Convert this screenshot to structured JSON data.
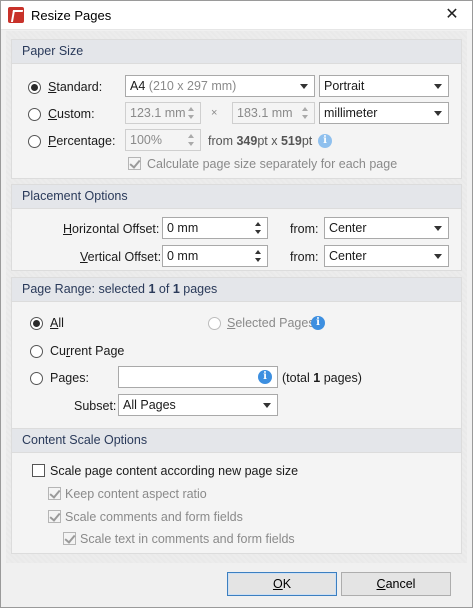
{
  "window": {
    "title": "Resize Pages",
    "close_glyph": "✕"
  },
  "paper_size": {
    "title": "Paper Size",
    "standard": {
      "label_u": "S",
      "label_rest": "tandard:",
      "size_value": "A4",
      "size_detail": "(210 x 297 mm)",
      "orientation": "Portrait",
      "selected": true
    },
    "custom": {
      "label_u": "C",
      "label_rest": "ustom:",
      "width": "123.1 mm",
      "times": "×",
      "height": "183.1 mm",
      "unit": "millimeter",
      "selected": false
    },
    "percentage": {
      "label_u": "P",
      "label_rest": "ercentage:",
      "value": "100%",
      "from_prefix": "from ",
      "from_w": "349",
      "from_mid": "pt x ",
      "from_h": "519",
      "from_suffix": "pt",
      "selected": false
    },
    "calc_separately": {
      "label": "Calculate page size separately for each page",
      "checked": true,
      "enabled": false
    }
  },
  "placement": {
    "title": "Placement Options",
    "horizontal": {
      "label_u": "H",
      "label_rest": "orizontal Offset:",
      "value": "0 mm",
      "from_label": "from:",
      "from_value": "Center"
    },
    "vertical": {
      "label_u": "V",
      "label_rest": "ertical Offset:",
      "value": "0 mm",
      "from_label": "from:",
      "from_value": "Center"
    }
  },
  "page_range": {
    "title_prefix": "Page Range: selected ",
    "selected": "1",
    "title_mid": " of ",
    "total": "1",
    "title_suffix": " pages",
    "all": {
      "label_u": "A",
      "label_rest": "ll",
      "selected": true
    },
    "selected_pages": {
      "label_u": "S",
      "label_rest": "elected Pages",
      "enabled": false
    },
    "current_page": {
      "label_pre": "Cu",
      "label_u": "r",
      "label_rest": "rent Page",
      "selected": false
    },
    "pages": {
      "label_pre": "Pa",
      "label_u": "g",
      "label_rest": "es:",
      "value": "",
      "total_prefix": "(total ",
      "total_count": "1",
      "total_suffix": " pages)",
      "selected": false
    },
    "subset": {
      "label": "Subset:",
      "value": "All Pages"
    }
  },
  "content_scale": {
    "title": "Content Scale Options",
    "scale_content": {
      "label": "Scale page content according new page size",
      "checked": false
    },
    "keep_aspect": {
      "label": "Keep content aspect ratio",
      "checked": true,
      "enabled": false
    },
    "scale_comments": {
      "label": "Scale comments and form fields",
      "checked": true,
      "enabled": false
    },
    "scale_text": {
      "label": "Scale text in comments and form fields",
      "checked": true,
      "enabled": false
    }
  },
  "buttons": {
    "ok_u": "O",
    "ok_rest": "K",
    "cancel_u": "C",
    "cancel_rest": "ancel"
  },
  "colors": {
    "accent": "#3d8fe0",
    "group_header": "#e4e6ea",
    "app_icon": "#c8322a"
  }
}
